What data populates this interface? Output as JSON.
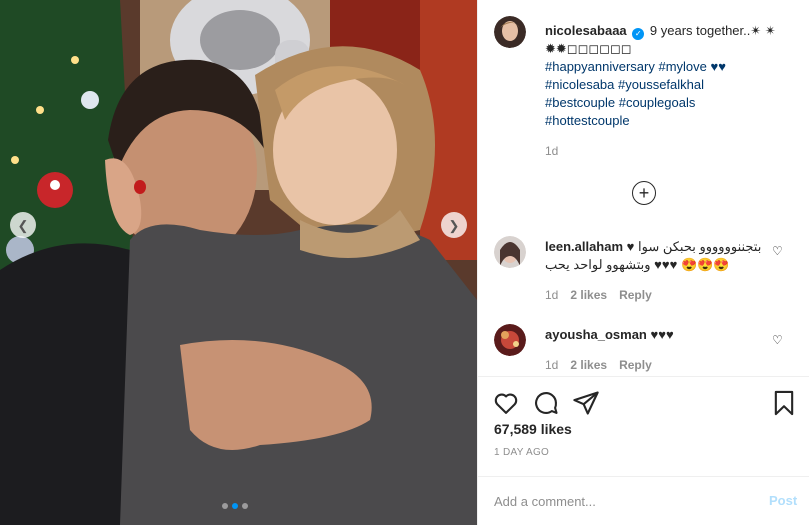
{
  "post": {
    "author": "nicolesabaaa",
    "caption_text": "9 years together..✴ ✴ ✹✹◻◻◻◻◻◻",
    "hashtags_line1": "#happyanniversary #mylove ♥♥",
    "hashtags_line2": "#nicolesaba #youssefalkhal",
    "hashtags_line3": "#bestcouple #couplegoals",
    "hashtags_line4": "#hottestcouple",
    "caption_age": "1d",
    "likes": "67,589 likes",
    "date": "1 DAY AGO"
  },
  "comments": [
    {
      "user": "leen.allaham",
      "text_line1": "♥ بتجننوووووو بحبكن سوا",
      "text_line2": "وبتشهوو لواحد يحب ♥♥♥ 😍😍😍",
      "age": "1d",
      "likes": "2 likes",
      "reply": "Reply"
    },
    {
      "user": "ayousha_osman",
      "text_line1": "♥♥♥",
      "age": "1d",
      "likes": "2 likes",
      "reply": "Reply"
    }
  ],
  "composer": {
    "placeholder": "Add a comment...",
    "post_label": "Post"
  },
  "colors": {
    "accent": "#0095f6",
    "link": "#00376b",
    "muted": "#8e8e8e",
    "post_disabled": "#b2dffc"
  },
  "icons": {
    "like": "heart-outline-icon",
    "comment": "speech-bubble-icon",
    "share": "paper-plane-icon",
    "save": "bookmark-icon",
    "more_comments": "plus-circle-icon"
  },
  "carousel": {
    "slide_count": 3,
    "active_slide": 1
  }
}
